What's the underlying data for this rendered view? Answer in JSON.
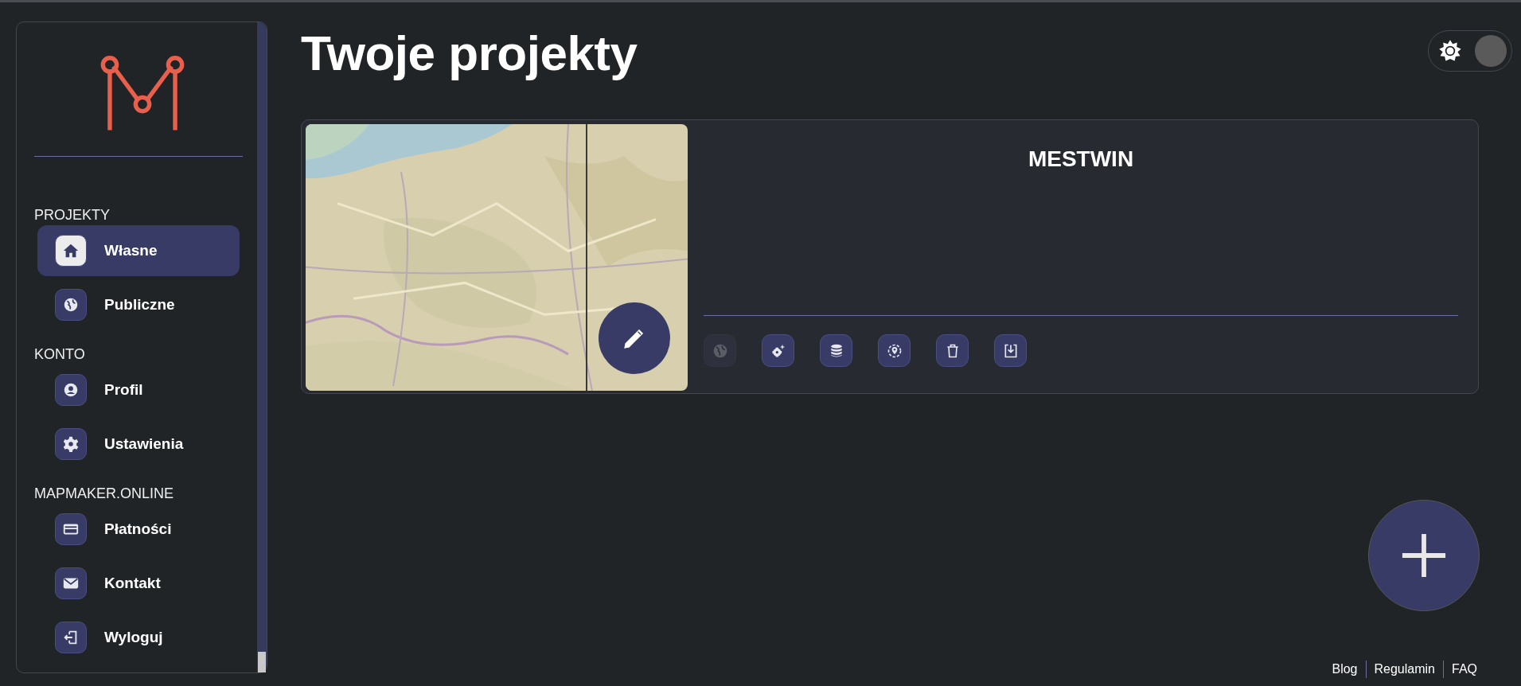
{
  "sidebar": {
    "sections": [
      {
        "title": "PROJEKTY",
        "items": [
          {
            "label": "Własne",
            "selected": true
          },
          {
            "label": "Publiczne",
            "selected": false
          }
        ]
      },
      {
        "title": "KONTO",
        "items": [
          {
            "label": "Profil",
            "selected": false
          },
          {
            "label": "Ustawienia",
            "selected": false
          }
        ]
      },
      {
        "title": "MAPMAKER.ONLINE",
        "items": [
          {
            "label": "Płatności",
            "selected": false
          },
          {
            "label": "Kontakt",
            "selected": false
          },
          {
            "label": "Wyloguj",
            "selected": false
          }
        ]
      }
    ]
  },
  "page_title": "Twoje projekty",
  "theme_toggle": {
    "on": true
  },
  "projects": [
    {
      "name": "MESTWIN",
      "actions": [
        {
          "disabled": true
        },
        {
          "disabled": false
        },
        {
          "disabled": false
        },
        {
          "disabled": false
        },
        {
          "disabled": false
        },
        {
          "disabled": false
        }
      ]
    }
  ],
  "footer_links": [
    "Blog",
    "Regulamin",
    "FAQ"
  ]
}
